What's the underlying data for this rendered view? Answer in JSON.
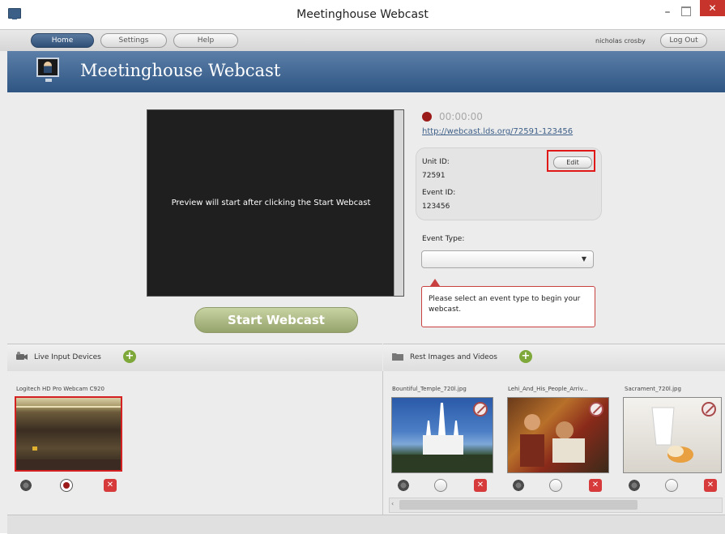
{
  "window": {
    "title": "Meetinghouse Webcast"
  },
  "nav": {
    "home": "Home",
    "settings": "Settings",
    "help": "Help",
    "username": "nicholas crosby",
    "logout": "Log Out"
  },
  "header": {
    "title": "Meetinghouse Webcast"
  },
  "preview": {
    "message": "Preview will start after clicking the Start Webcast",
    "start_label": "Start Webcast"
  },
  "status": {
    "timer": "00:00:00",
    "url": "http://webcast.lds.org/72591-123456"
  },
  "unit": {
    "unit_label": "Unit ID:",
    "unit_value": "72591",
    "event_label": "Event ID:",
    "event_value": "123456",
    "edit_label": "Edit"
  },
  "event_type": {
    "label": "Event Type:",
    "selected": "",
    "warning": "Please select an event type to begin your webcast."
  },
  "devices": {
    "title": "Live Input Devices",
    "items": [
      {
        "name": "Logitech HD Pro Webcam C920"
      }
    ]
  },
  "media": {
    "title": "Rest Images and Videos",
    "items": [
      {
        "name": "Bountiful_Temple_720l.jpg"
      },
      {
        "name": "Lehi_And_His_People_Arriv..."
      },
      {
        "name": "Sacrament_720l.jpg"
      }
    ]
  },
  "colors": {
    "accent": "#2f5583",
    "record": "#9b1a1a",
    "add": "#7fa83a",
    "alert": "#c94040"
  }
}
